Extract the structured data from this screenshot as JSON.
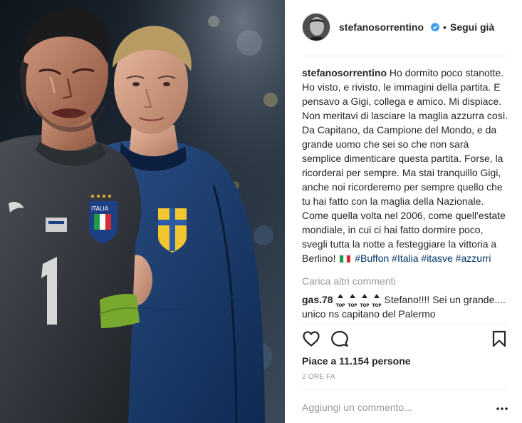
{
  "post": {
    "author": "stefanosorrentino",
    "verified_icon": "verified-badge-icon",
    "follow_label": "Segui già",
    "caption_author": "stefanosorrentino",
    "caption_text": "Ho dormito poco stanotte. Ho visto, e rivisto, le immagini della partita. E pensavo a Gigi, collega e amico. Mi dispiace. Non meritavi di lasciare la maglia azzurra così. Da Capitano, da Campione del Mondo, e da grande uomo che sei so che non sarà semplice dimenticare questa partita. Forse, la ricorderai per sempre. Ma stai tranquillo Gigi, anche noi ricorderemo per sempre quello che tu hai fatto con la maglia della Nazionale. Come quella volta nel 2006, come quell'estate mondiale, in cui ci hai fatto dormire poco, svegli tutta la notte a festeggiare la vittoria a Berlino!",
    "hashtags": [
      "#Buffon",
      "#Italia",
      "#itasve",
      "#azzurri"
    ],
    "load_more": "Carica altri commenti",
    "comment": {
      "author": "gas.78",
      "emoji_label": "TOP",
      "text": "Stefano!!!! Sei un grande.... unico ns capitano del Palermo"
    },
    "likes": "Piace a 11.154 persone",
    "time": "2 ORE FA",
    "add_comment_placeholder": "Aggiungi un commento...",
    "icons": {
      "like": "heart-icon",
      "comment": "comment-icon",
      "save": "bookmark-icon",
      "more": "more-options-icon"
    },
    "colors": {
      "text": "#262626",
      "muted": "#999999",
      "link": "#003569",
      "verified": "#3897f0",
      "divider": "#efefef"
    }
  }
}
